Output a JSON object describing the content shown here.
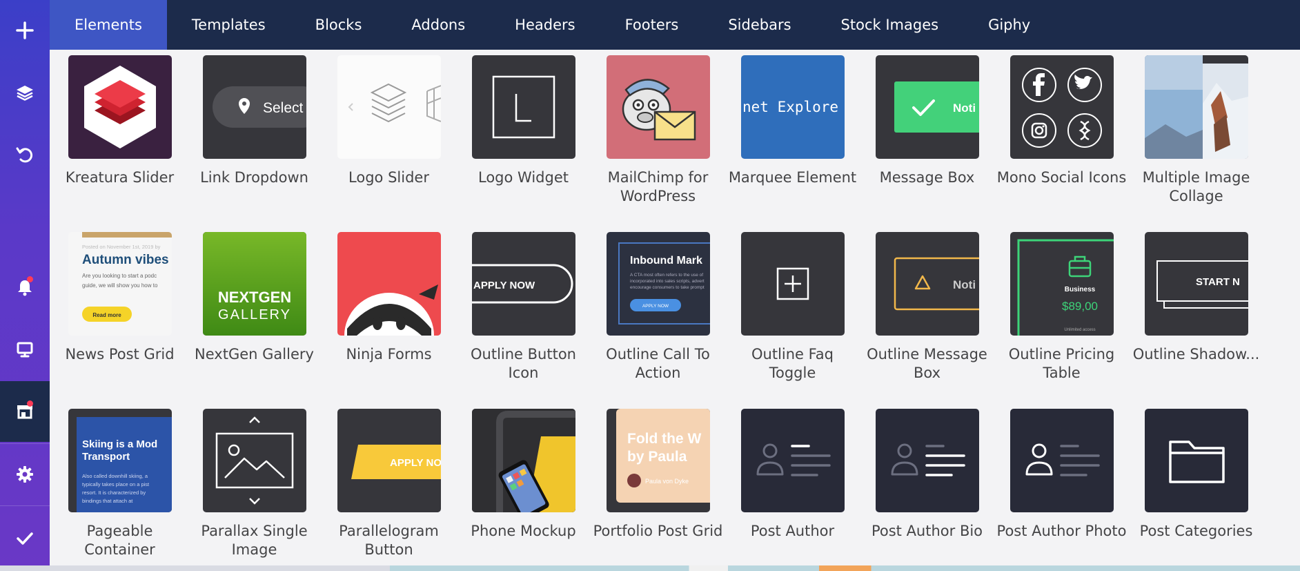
{
  "rail": {
    "icons": [
      "plus-icon",
      "layers-icon",
      "undo-icon",
      "bell-icon",
      "monitor-icon",
      "store-icon",
      "gear-icon",
      "check-icon"
    ],
    "accent": "#3e56c4",
    "badge_color": "#ff3b57"
  },
  "tabs": [
    {
      "label": "Elements",
      "active": true
    },
    {
      "label": "Templates"
    },
    {
      "label": "Blocks"
    },
    {
      "label": "Addons"
    },
    {
      "label": "Headers"
    },
    {
      "label": "Footers"
    },
    {
      "label": "Sidebars"
    },
    {
      "label": "Stock Images"
    },
    {
      "label": "Giphy"
    }
  ],
  "thumb_text": {
    "link_dropdown": "Select",
    "marquee": "net Explore",
    "message_box": "Noti",
    "news_headline": "Autumn vibes",
    "news_meta": "Posted on November 1st, 2019 by",
    "news_body1": "Are you looking to start a podc",
    "news_body2": "guide, we will show you how to",
    "news_button": "Read more",
    "nextgen1": "NEXTGEN",
    "nextgen2": "GALLERY",
    "apply_now": "APPLY NOW",
    "inbound": "Inbound Mark",
    "cta_line1": "A CTA most often refers to the use of",
    "cta_line2": "incorporated into sales scripts, advert",
    "cta_line3": "encourage consumers to take prompt",
    "cta_button": "APPLY NOW",
    "outline_message": "Noti",
    "business": "Business",
    "price": "$89,00",
    "unlimited": "Unlimited access",
    "start_now": "START N",
    "pageable1": "Skiing is a Mod",
    "pageable2": "Transport",
    "pageable_body1": "Also called downhill skiing, a",
    "pageable_body2": "typically takes place on a pist",
    "pageable_body3": "resort. It is characterized by",
    "pageable_body4": "bindings that attach at",
    "apply_no": "APPLY NO",
    "fold1": "Fold the W",
    "fold2": "by Paula",
    "fold_author": "Paula von Dyke"
  },
  "items": [
    {
      "label": "Kreatura Slider",
      "thumb": "kreatura"
    },
    {
      "label": "Link Dropdown",
      "thumb": "link-dropdown"
    },
    {
      "label": "Logo Slider",
      "thumb": "logo-slider"
    },
    {
      "label": "Logo Widget",
      "thumb": "logo-widget"
    },
    {
      "label": "MailChimp for WordPress",
      "thumb": "mailchimp"
    },
    {
      "label": "Marquee Element",
      "thumb": "marquee"
    },
    {
      "label": "Message Box",
      "thumb": "message-box"
    },
    {
      "label": "Mono Social Icons",
      "thumb": "mono-social"
    },
    {
      "label": "Multiple Image Collage",
      "thumb": "collage"
    },
    {
      "label": "News Post Grid",
      "thumb": "news-grid"
    },
    {
      "label": "NextGen Gallery",
      "thumb": "nextgen"
    },
    {
      "label": "Ninja Forms",
      "thumb": "ninja"
    },
    {
      "label": "Outline Button Icon",
      "thumb": "outline-button"
    },
    {
      "label": "Outline Call To Action",
      "thumb": "outline-cta"
    },
    {
      "label": "Outline Faq Toggle",
      "thumb": "outline-faq"
    },
    {
      "label": "Outline Message Box",
      "thumb": "outline-message"
    },
    {
      "label": "Outline Pricing Table",
      "thumb": "outline-pricing"
    },
    {
      "label": "Outline Shadow...",
      "thumb": "outline-shadow"
    },
    {
      "label": "Pageable Container",
      "thumb": "pageable"
    },
    {
      "label": "Parallax Single Image",
      "thumb": "parallax"
    },
    {
      "label": "Parallelogram Button",
      "thumb": "parallelogram"
    },
    {
      "label": "Phone Mockup",
      "thumb": "phone"
    },
    {
      "label": "Portfolio Post Grid",
      "thumb": "portfolio"
    },
    {
      "label": "Post Author",
      "thumb": "post-author"
    },
    {
      "label": "Post Author Bio",
      "thumb": "post-author-bio"
    },
    {
      "label": "Post Author Photo",
      "thumb": "post-author-photo"
    },
    {
      "label": "Post Categories",
      "thumb": "post-categories"
    }
  ]
}
